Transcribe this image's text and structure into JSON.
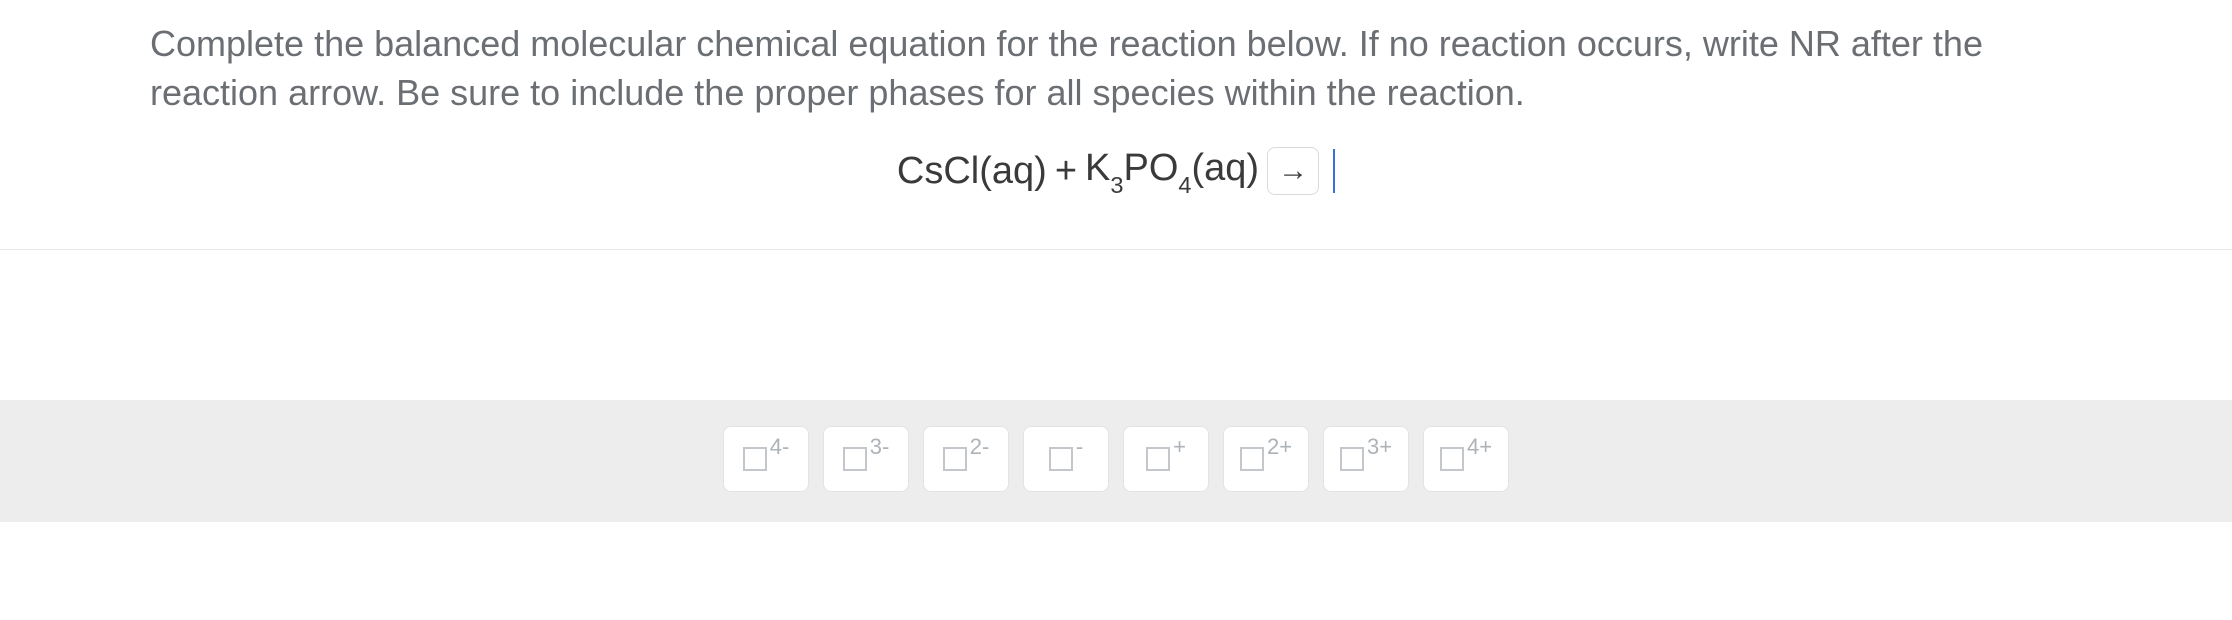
{
  "question": {
    "text": "Complete the balanced molecular chemical equation for the reaction below. If no reaction occurs, write NR after the reaction arrow. Be sure to include the proper phases for all species within the reaction."
  },
  "equation": {
    "reactant1_base": "CsCl(aq)",
    "plus": " + ",
    "reactant2_prefix": "K",
    "reactant2_sub1": "3",
    "reactant2_mid": "PO",
    "reactant2_sub2": "4",
    "reactant2_suffix": "(aq)",
    "arrow": "→"
  },
  "toolbar": {
    "charges": [
      {
        "label": "4-"
      },
      {
        "label": "3-"
      },
      {
        "label": "2-"
      },
      {
        "label": "-"
      },
      {
        "label": "+"
      },
      {
        "label": "2+"
      },
      {
        "label": "3+"
      },
      {
        "label": "4+"
      }
    ]
  }
}
